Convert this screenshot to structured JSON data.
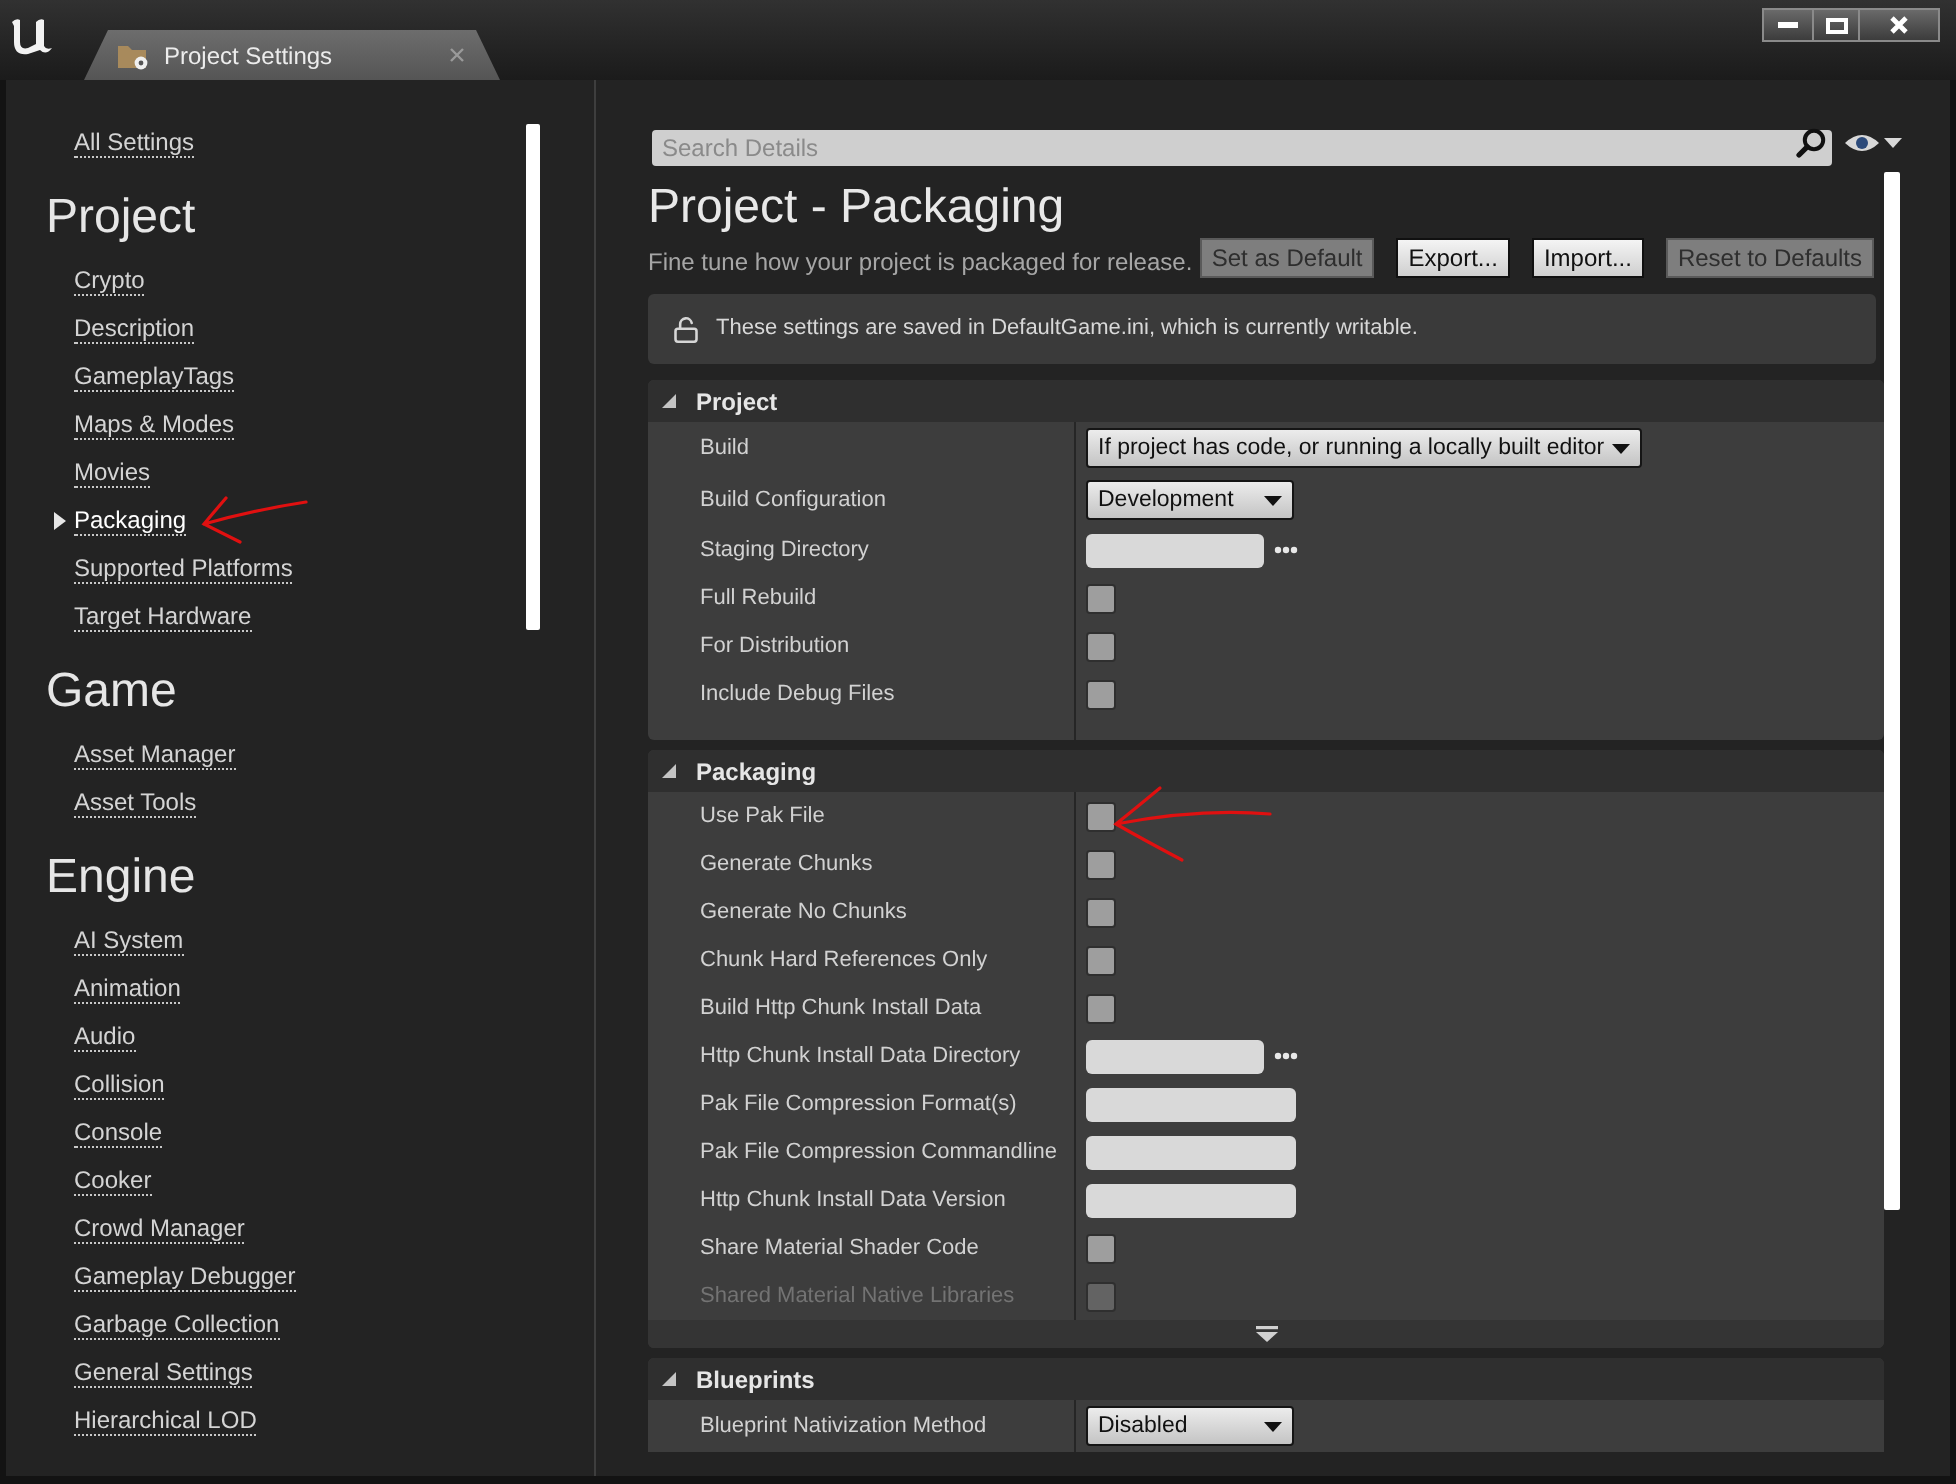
{
  "window": {
    "tab": {
      "title": "Project Settings"
    }
  },
  "sidebar": {
    "top_link": {
      "label": "All Settings",
      "selected": false
    },
    "sections": [
      {
        "heading": "Project",
        "items": [
          {
            "label": "Crypto",
            "selected": false
          },
          {
            "label": "Description",
            "selected": false
          },
          {
            "label": "GameplayTags",
            "selected": false
          },
          {
            "label": "Maps & Modes",
            "selected": false
          },
          {
            "label": "Movies",
            "selected": false
          },
          {
            "label": "Packaging",
            "selected": true
          },
          {
            "label": "Supported Platforms",
            "selected": false
          },
          {
            "label": "Target Hardware",
            "selected": false
          }
        ]
      },
      {
        "heading": "Game",
        "items": [
          {
            "label": "Asset Manager",
            "selected": false
          },
          {
            "label": "Asset Tools",
            "selected": false
          }
        ]
      },
      {
        "heading": "Engine",
        "items": [
          {
            "label": "AI System",
            "selected": false
          },
          {
            "label": "Animation",
            "selected": false
          },
          {
            "label": "Audio",
            "selected": false
          },
          {
            "label": "Collision",
            "selected": false
          },
          {
            "label": "Console",
            "selected": false
          },
          {
            "label": "Cooker",
            "selected": false
          },
          {
            "label": "Crowd Manager",
            "selected": false
          },
          {
            "label": "Gameplay Debugger",
            "selected": false
          },
          {
            "label": "Garbage Collection",
            "selected": false
          },
          {
            "label": "General Settings",
            "selected": false
          },
          {
            "label": "Hierarchical LOD",
            "selected": false
          }
        ]
      }
    ]
  },
  "details": {
    "search": {
      "placeholder": "Search Details"
    },
    "title": "Project - Packaging",
    "description": "Fine tune how your project is packaged for release.",
    "buttons": [
      {
        "label": "Set as Default",
        "disabled": true
      },
      {
        "label": "Export...",
        "disabled": false
      },
      {
        "label": "Import...",
        "disabled": false
      },
      {
        "label": "Reset to Defaults",
        "disabled": true
      }
    ],
    "notice": "These settings are saved in DefaultGame.ini, which is currently writable.",
    "categories": [
      {
        "title": "Project",
        "expanded": true,
        "advanced_toggle": false,
        "rows": [
          {
            "label": "Build",
            "kind": "dropdown",
            "value": "If project has code, or running a locally built editor",
            "disabled": false
          },
          {
            "label": "Build Configuration",
            "kind": "dropdown",
            "value": "Development",
            "disabled": false
          },
          {
            "label": "Staging Directory",
            "kind": "path",
            "disabled": false
          },
          {
            "label": "Full Rebuild",
            "kind": "checkbox",
            "checked": false,
            "disabled": false
          },
          {
            "label": "For Distribution",
            "kind": "checkbox",
            "checked": false,
            "disabled": false
          },
          {
            "label": "Include Debug Files",
            "kind": "checkbox",
            "checked": false,
            "disabled": false
          }
        ]
      },
      {
        "title": "Packaging",
        "expanded": true,
        "advanced_toggle": true,
        "rows": [
          {
            "label": "Use Pak File",
            "kind": "checkbox",
            "checked": false,
            "disabled": false
          },
          {
            "label": "Generate Chunks",
            "kind": "checkbox",
            "checked": false,
            "disabled": false
          },
          {
            "label": "Generate No Chunks",
            "kind": "checkbox",
            "checked": false,
            "disabled": false
          },
          {
            "label": "Chunk Hard References Only",
            "kind": "checkbox",
            "checked": false,
            "disabled": false
          },
          {
            "label": "Build Http Chunk Install Data",
            "kind": "checkbox",
            "checked": false,
            "disabled": false
          },
          {
            "label": "Http Chunk Install Data Directory",
            "kind": "path",
            "disabled": false
          },
          {
            "label": "Pak File Compression Format(s)",
            "kind": "text",
            "disabled": false
          },
          {
            "label": "Pak File Compression Commandline",
            "kind": "text",
            "disabled": false
          },
          {
            "label": "Http Chunk Install Data Version",
            "kind": "text",
            "disabled": false
          },
          {
            "label": "Share Material Shader Code",
            "kind": "checkbox",
            "checked": false,
            "disabled": false
          },
          {
            "label": "Shared Material Native Libraries",
            "kind": "checkbox",
            "checked": false,
            "disabled": true
          }
        ]
      },
      {
        "title": "Blueprints",
        "expanded": true,
        "advanced_toggle": false,
        "rows": [
          {
            "label": "Blueprint Nativization Method",
            "kind": "dropdown",
            "value": "Disabled",
            "disabled": false
          }
        ]
      }
    ]
  }
}
